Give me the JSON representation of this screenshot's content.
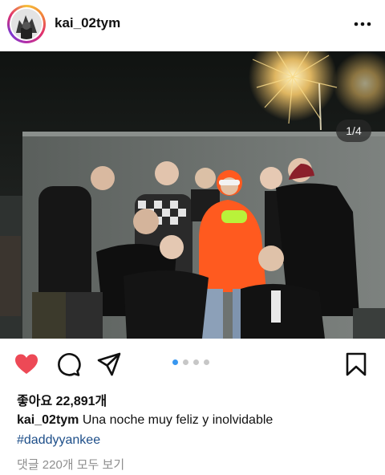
{
  "post": {
    "username": "kai_02tym",
    "image_counter": "1/4",
    "likes_label": "좋아요 22,891개",
    "caption_username": "kai_02tym",
    "caption_text": "Una noche muy feliz y inolvidable",
    "hashtag": "#daddyyankee",
    "comments_link": "댓글 220개 모두 보기",
    "carousel": {
      "total": 4,
      "active_index": 0
    }
  },
  "colors": {
    "like_active": "#ed4956",
    "hashtag": "#1d4e89",
    "muted_text": "#8e8e8e",
    "carousel_dot_active": "#3897f0",
    "carousel_dot_inactive": "#c7c7c7",
    "hoodie": "#ff5a1f"
  },
  "icons": {
    "more": "more-horizontal-icon",
    "like": "heart-icon",
    "comment": "comment-icon",
    "share": "send-icon",
    "save": "bookmark-icon"
  }
}
